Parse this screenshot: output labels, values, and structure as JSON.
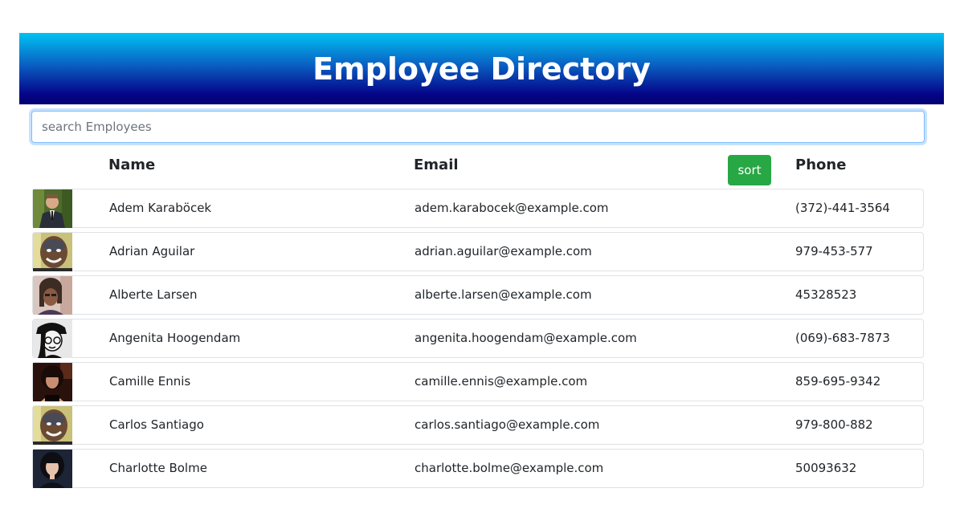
{
  "header": {
    "title": "Employee Directory"
  },
  "search": {
    "placeholder": "search Employees",
    "value": ""
  },
  "table": {
    "columns": {
      "name": "Name",
      "email": "Email",
      "phone": "Phone"
    },
    "sort_label": "sort",
    "rows": [
      {
        "name": "Adem Karaböcek",
        "email": "adem.karabocek@example.com",
        "phone": "(372)-441-3564",
        "avatar": "photo-man-suit"
      },
      {
        "name": "Adrian Aguilar",
        "email": "adrian.aguilar@example.com",
        "phone": "979-453-577",
        "avatar": "photo-man-painted-face"
      },
      {
        "name": "Alberte Larsen",
        "email": "alberte.larsen@example.com",
        "phone": "45328523",
        "avatar": "photo-woman-dreadlocks"
      },
      {
        "name": "Angenita Hoogendam",
        "email": "angenita.hoogendam@example.com",
        "phone": "(069)-683-7873",
        "avatar": "illustration-woman-black-white"
      },
      {
        "name": "Camille Ennis",
        "email": "camille.ennis@example.com",
        "phone": "859-695-9342",
        "avatar": "photo-woman-dark"
      },
      {
        "name": "Carlos Santiago",
        "email": "carlos.santiago@example.com",
        "phone": "979-800-882",
        "avatar": "photo-man-painted-face"
      },
      {
        "name": "Charlotte Bolme",
        "email": "charlotte.bolme@example.com",
        "phone": "50093632",
        "avatar": "photo-woman-dark-hair"
      }
    ]
  },
  "colors": {
    "header_top": "#00c3f3",
    "header_bottom": "#020070",
    "sort_button": "#28a745",
    "search_focus_border": "#80bdff"
  }
}
